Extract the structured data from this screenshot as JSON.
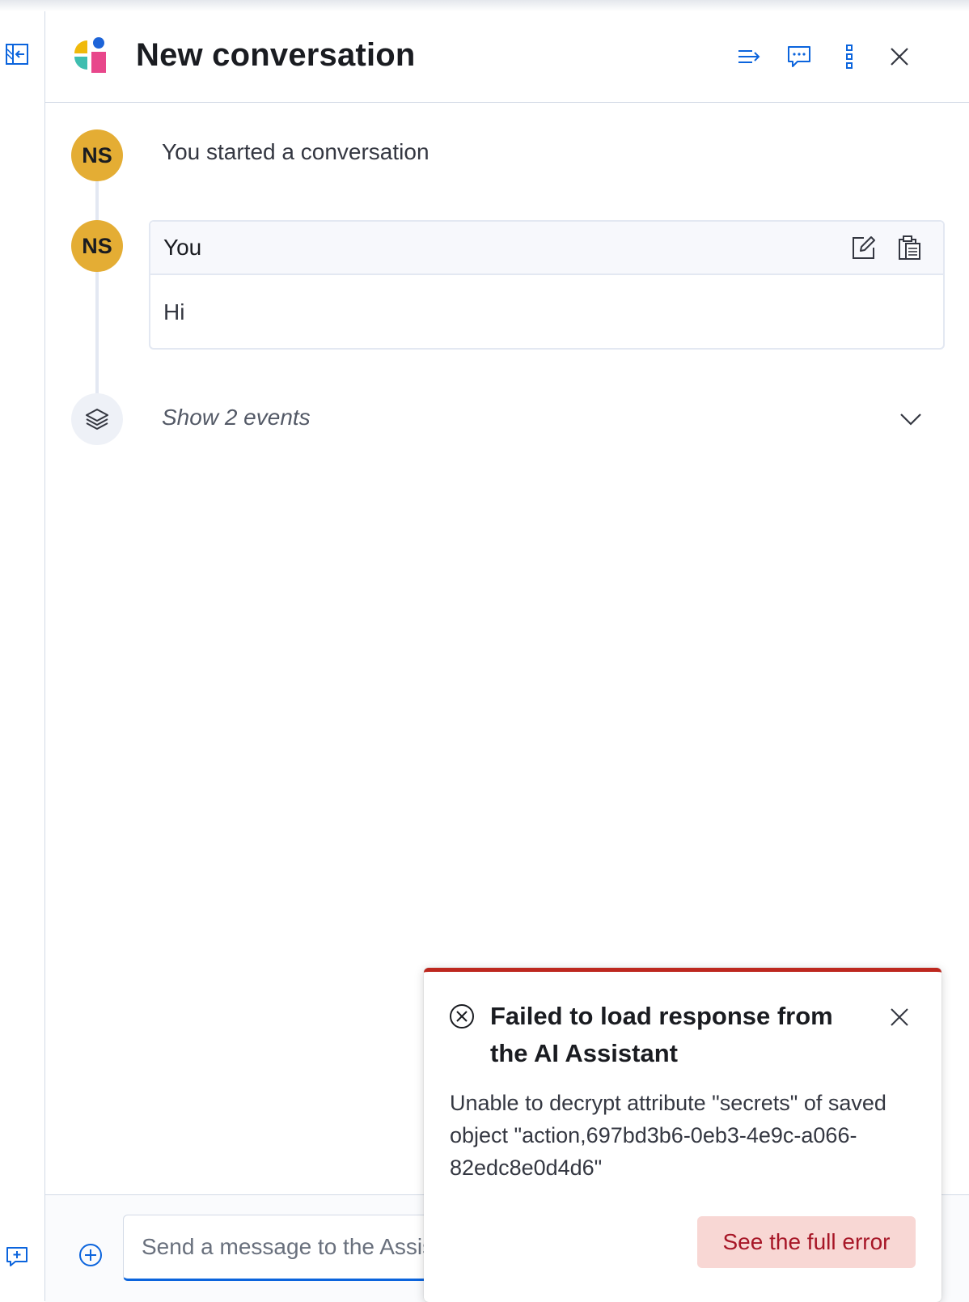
{
  "header": {
    "title": "New conversation",
    "icons": [
      "collapse-panel-icon",
      "expand-list-icon",
      "chat-icon",
      "more-vertical-icon",
      "close-icon"
    ]
  },
  "timeline": {
    "avatar_initials": "NS",
    "started_text": "You started a conversation",
    "message": {
      "author": "You",
      "body": "Hi"
    },
    "events_toggle": "Show 2 events"
  },
  "footer": {
    "input_placeholder": "Send a message to the Assistant"
  },
  "toast": {
    "title": "Failed to load response from the AI Assistant",
    "body": "Unable to decrypt attribute \"secrets\" of saved object \"action,697bd3b6-0eb3-4e9c-a066-82edc8e0d4d6\"",
    "button": "See the full error"
  },
  "colors": {
    "accent": "#0b64dd",
    "avatar": "#e4ad34",
    "danger": "#bd271e",
    "danger_bg": "#f8d7d4"
  }
}
